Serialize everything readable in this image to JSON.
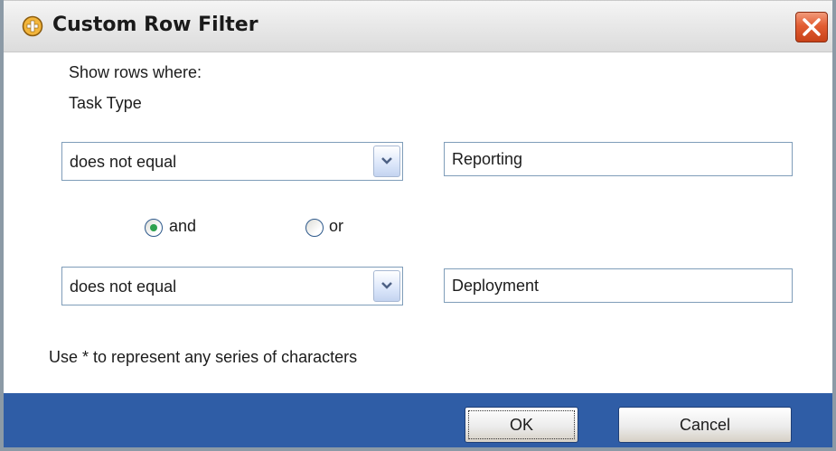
{
  "window": {
    "title": "Custom Row Filter"
  },
  "labels": {
    "show_rows_where": "Show rows where:",
    "column_name": "Task Type",
    "hint": "Use * to represent any series of characters"
  },
  "condition1": {
    "operator": "does not equal",
    "value": "Reporting"
  },
  "logic": {
    "and_label": "and",
    "or_label": "or",
    "selected": "and"
  },
  "condition2": {
    "operator": "does not equal",
    "value": "Deployment"
  },
  "buttons": {
    "ok": "OK",
    "cancel": "Cancel"
  },
  "colors": {
    "footer": "#2f5da6",
    "close_button": "#e25d33",
    "radio_selected": "#2ea14d"
  },
  "icons": {
    "title": "add-filter-icon",
    "close": "close-icon",
    "dropdown": "chevron-down-icon"
  }
}
